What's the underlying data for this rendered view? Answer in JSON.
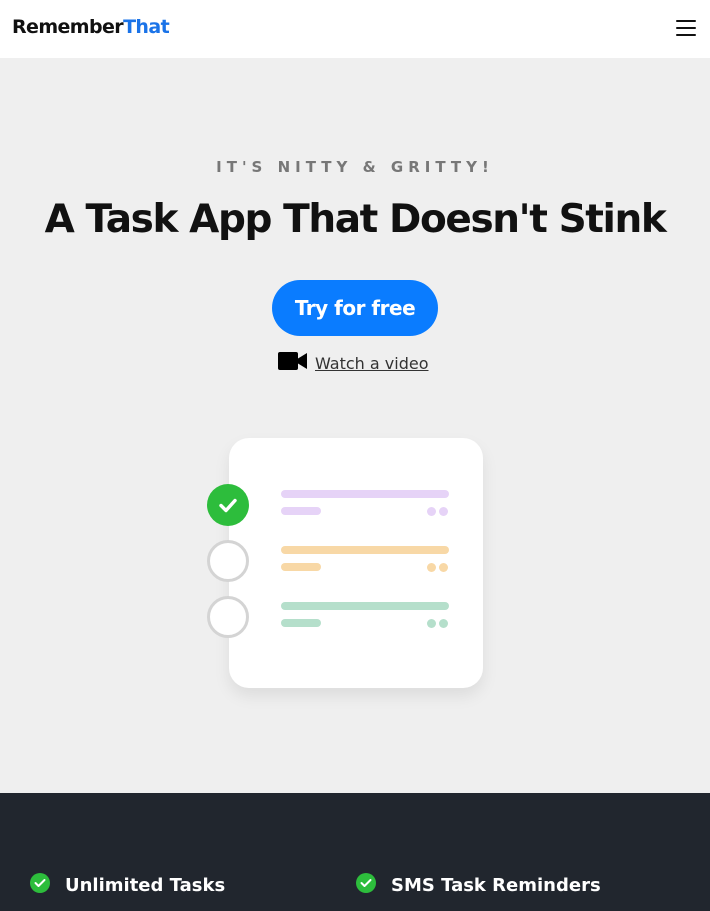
{
  "header": {
    "logo_part1": "Remember",
    "logo_part2": "That",
    "menu_icon": "hamburger-menu-icon"
  },
  "hero": {
    "eyebrow": "IT'S NITTY & GRITTY!",
    "headline": "A Task App That Doesn't Stink",
    "cta_label": "Try for free",
    "video_icon": "video-camera-icon",
    "video_link": "Watch a video"
  },
  "illustration": {
    "tasks": [
      {
        "done": true,
        "color": "#e6d3f7"
      },
      {
        "done": false,
        "color": "#f8d8a6"
      },
      {
        "done": false,
        "color": "#b5dfcb"
      }
    ]
  },
  "features": [
    {
      "label": "Unlimited Tasks",
      "icon": "green-check-icon"
    },
    {
      "label": "SMS Task Reminders",
      "icon": "green-check-icon"
    }
  ],
  "colors": {
    "brand_blue": "#0a7cff",
    "check_green": "#2dbd3c",
    "dark_band": "#21262e"
  }
}
